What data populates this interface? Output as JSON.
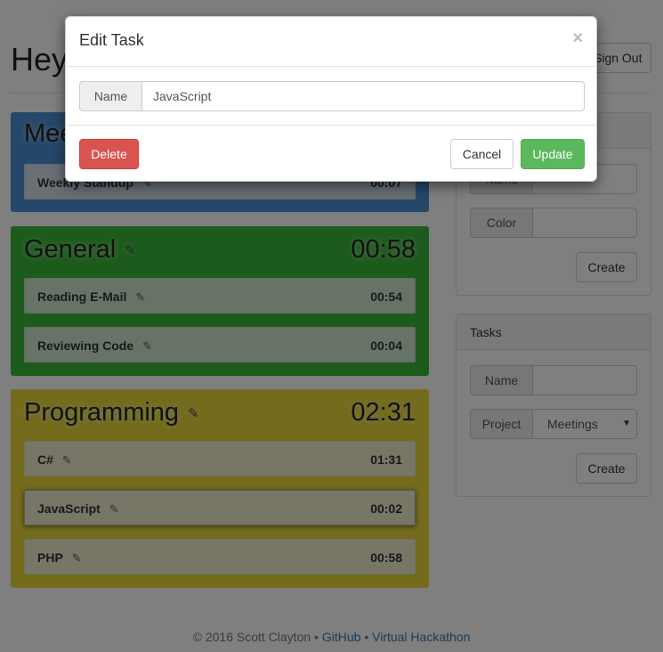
{
  "header": {
    "greeting": "Hey",
    "sign_out_label": "Sign Out"
  },
  "projects": [
    {
      "name": "Meetings",
      "time": "",
      "color": "#4a8fd4",
      "tasks": [
        {
          "name": "Weekly Standup",
          "time": "00:07"
        }
      ]
    },
    {
      "name": "General",
      "time": "00:58",
      "color": "#3ab73a",
      "tasks": [
        {
          "name": "Reading E-Mail",
          "time": "00:54"
        },
        {
          "name": "Reviewing Code",
          "time": "00:04"
        }
      ]
    },
    {
      "name": "Programming",
      "time": "02:31",
      "color": "#e8d73a",
      "tasks": [
        {
          "name": "C#",
          "time": "01:31"
        },
        {
          "name": "JavaScript",
          "time": "00:02"
        },
        {
          "name": "PHP",
          "time": "00:58"
        }
      ]
    }
  ],
  "projects_panel": {
    "name_label": "Name",
    "color_label": "Color",
    "create_label": "Create"
  },
  "tasks_panel": {
    "title": "Tasks",
    "name_label": "Name",
    "project_label": "Project",
    "project_selected": "Meetings",
    "create_label": "Create"
  },
  "footer": {
    "copyright": "© 2016 Scott Clayton",
    "sep": "•",
    "github": "GitHub",
    "hackathon": "Virtual Hackathon"
  },
  "modal": {
    "title": "Edit Task",
    "close_glyph": "×",
    "name_label": "Name",
    "name_value": "JavaScript",
    "delete_label": "Delete",
    "cancel_label": "Cancel",
    "update_label": "Update"
  },
  "icons": {
    "pencil": "✎",
    "caret": "▼"
  }
}
